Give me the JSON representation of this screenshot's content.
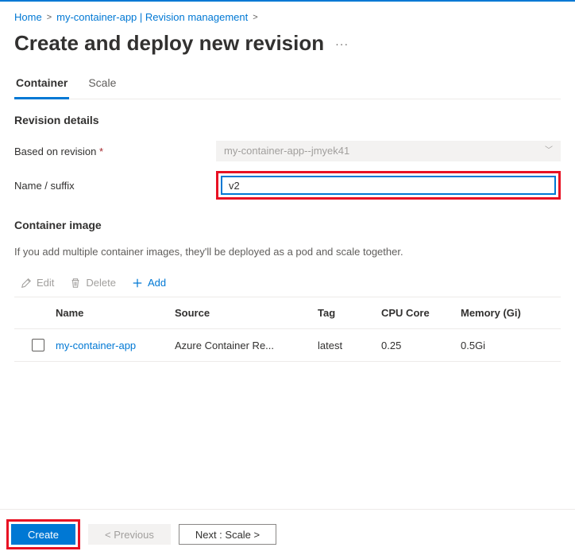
{
  "breadcrumb": {
    "home": "Home",
    "app": "my-container-app | Revision management"
  },
  "page": {
    "title": "Create and deploy new revision"
  },
  "tabs": {
    "container": "Container",
    "scale": "Scale"
  },
  "rev": {
    "heading": "Revision details",
    "based_label": "Based on revision",
    "based_value": "my-container-app--jmyek41",
    "name_label": "Name / suffix",
    "name_value": "v2"
  },
  "image": {
    "heading": "Container image",
    "hint": "If you add multiple container images, they'll be deployed as a pod and scale together."
  },
  "toolbar": {
    "edit": "Edit",
    "delete": "Delete",
    "add": "Add"
  },
  "table": {
    "cols": {
      "name": "Name",
      "source": "Source",
      "tag": "Tag",
      "cpu": "CPU Core",
      "mem": "Memory (Gi)"
    },
    "rows": [
      {
        "name": "my-container-app",
        "source": "Azure Container Re...",
        "tag": "latest",
        "cpu": "0.25",
        "mem": "0.5Gi"
      }
    ]
  },
  "footer": {
    "create": "Create",
    "previous": "< Previous",
    "next": "Next : Scale >"
  }
}
